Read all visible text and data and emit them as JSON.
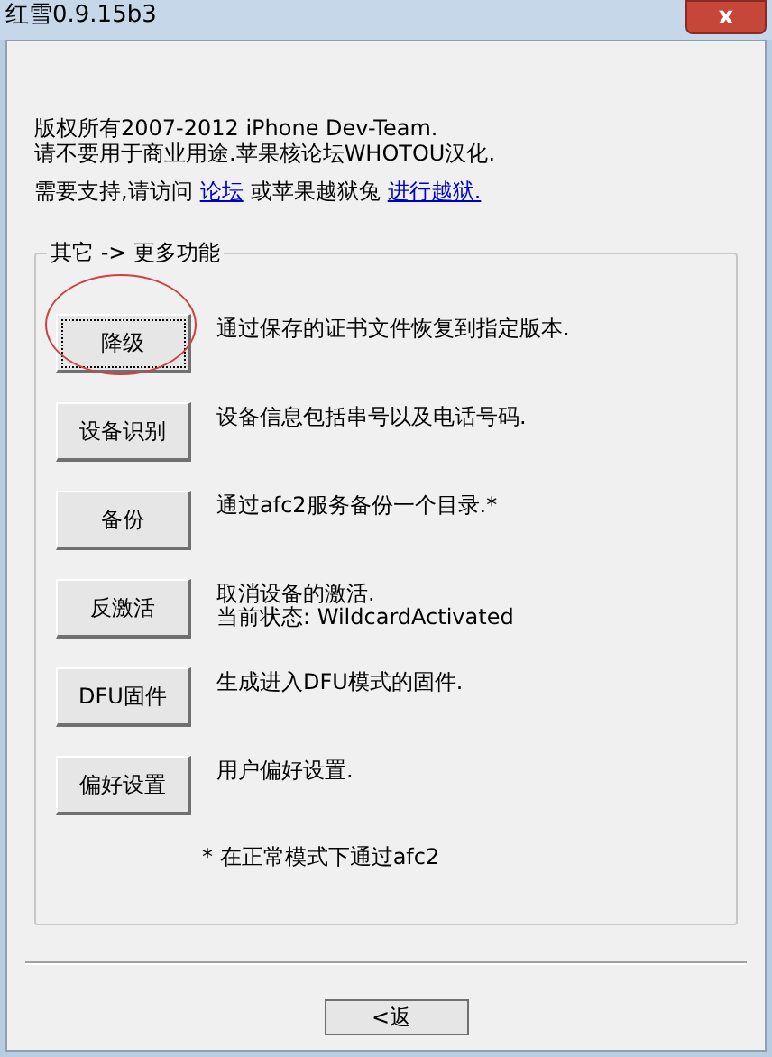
{
  "window": {
    "title": "红雪0.9.15b3",
    "close": "x"
  },
  "intro": {
    "lines": [
      "版权所有2007-2012 iPhone Dev-Team.",
      "请不要用于商业用途.苹果核论坛WHOTOU汉化."
    ],
    "support": {
      "text": "需要支持,请访问",
      "link1": "论坛",
      "middle": "或苹果越狱兔",
      "link2": "进行越狱."
    }
  },
  "group": {
    "title": "其它 -> 更多功能",
    "actions": [
      {
        "button": "降级",
        "focused": true,
        "circled": true,
        "lines": [
          "通过保存的证书文件恢复到指定版本."
        ]
      },
      {
        "button": "设备识别",
        "focused": false,
        "circled": false,
        "lines": [
          "设备信息包括串号以及电话号码."
        ]
      },
      {
        "button": "备份",
        "focused": false,
        "circled": false,
        "lines": [
          "通过afc2服务备份一个目录.*"
        ]
      },
      {
        "button": "反激活",
        "focused": false,
        "circled": false,
        "lines": [
          "取消设备的激活.",
          "当前状态: WildcardActivated"
        ]
      },
      {
        "button": "DFU固件",
        "focused": false,
        "circled": false,
        "lines": [
          "生成进入DFU模式的固件."
        ]
      },
      {
        "button": "偏好设置",
        "focused": false,
        "circled": false,
        "lines": [
          "用户偏好设置."
        ]
      }
    ],
    "footnote": "* 在正常模式下通过afc2"
  },
  "back_button": "<返"
}
